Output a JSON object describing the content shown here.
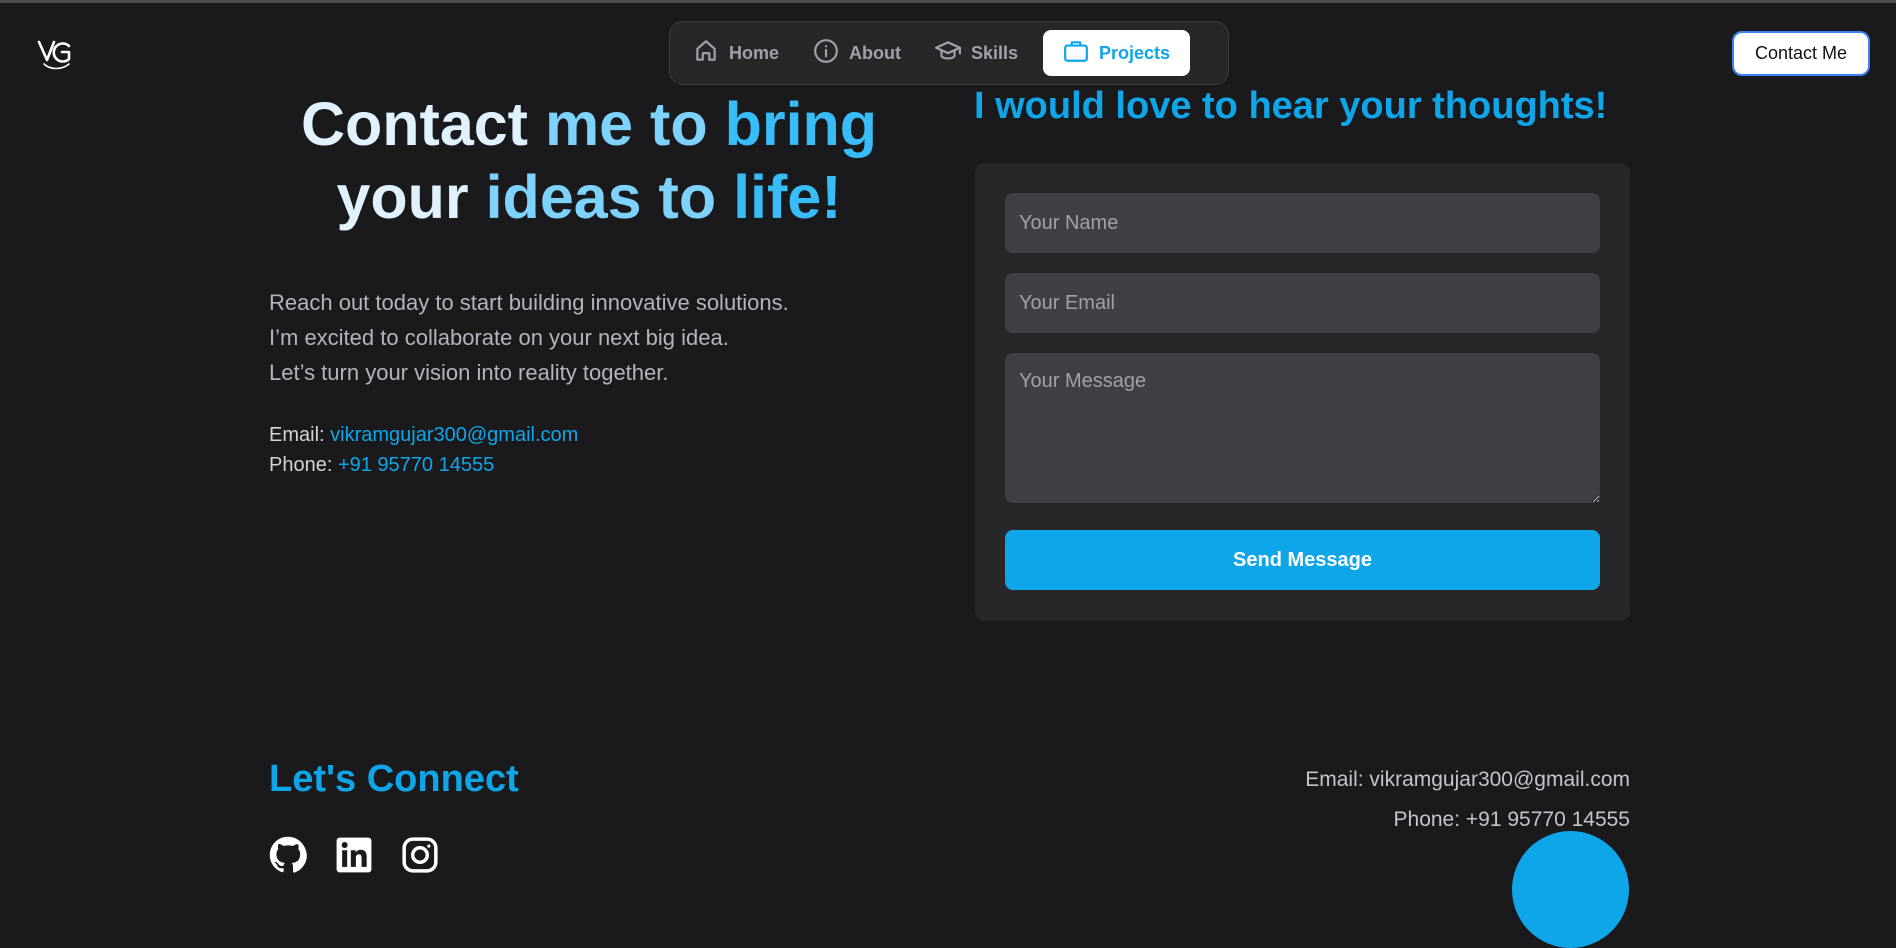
{
  "brand": {
    "logo_icon": "vg-monogram-logo"
  },
  "nav": {
    "items": [
      {
        "label": "Home",
        "icon": "home-icon"
      },
      {
        "label": "About",
        "icon": "info-icon"
      },
      {
        "label": "Skills",
        "icon": "graduation-cap-icon"
      },
      {
        "label": "Projects",
        "icon": "briefcase-icon",
        "active": true
      }
    ]
  },
  "header": {
    "contact_button": "Contact Me"
  },
  "hero": {
    "line1_a": "Contact ",
    "line1_b": "me to ",
    "line1_c": "bring",
    "line2_a": "your ",
    "line2_b": "ideas to ",
    "line2_c": "life!"
  },
  "intro": {
    "lines": [
      "Reach out today to start building innovative solutions.",
      "I’m excited to collaborate on your next big idea.",
      "Let’s turn your vision into reality together."
    ]
  },
  "contact": {
    "email_label": "Email: ",
    "email": "vikramgujar300@gmail.com",
    "phone_label": "Phone: ",
    "phone": "+91 95770 14555"
  },
  "form": {
    "title": "I would love to hear your thoughts!",
    "name_placeholder": "Your Name",
    "email_placeholder": "Your Email",
    "message_placeholder": "Your Message",
    "send_label": "Send Message"
  },
  "footer": {
    "connect_title": "Let's Connect",
    "socials": [
      "github-icon",
      "linkedin-icon",
      "instagram-icon"
    ],
    "email_line": "Email: vikramgujar300@gmail.com",
    "phone_line": "Phone: +91 95770 14555"
  },
  "colors": {
    "accent": "#0ea5e9",
    "background": "#1a1a1d",
    "card": "#27272a",
    "field": "#3f3f46"
  }
}
